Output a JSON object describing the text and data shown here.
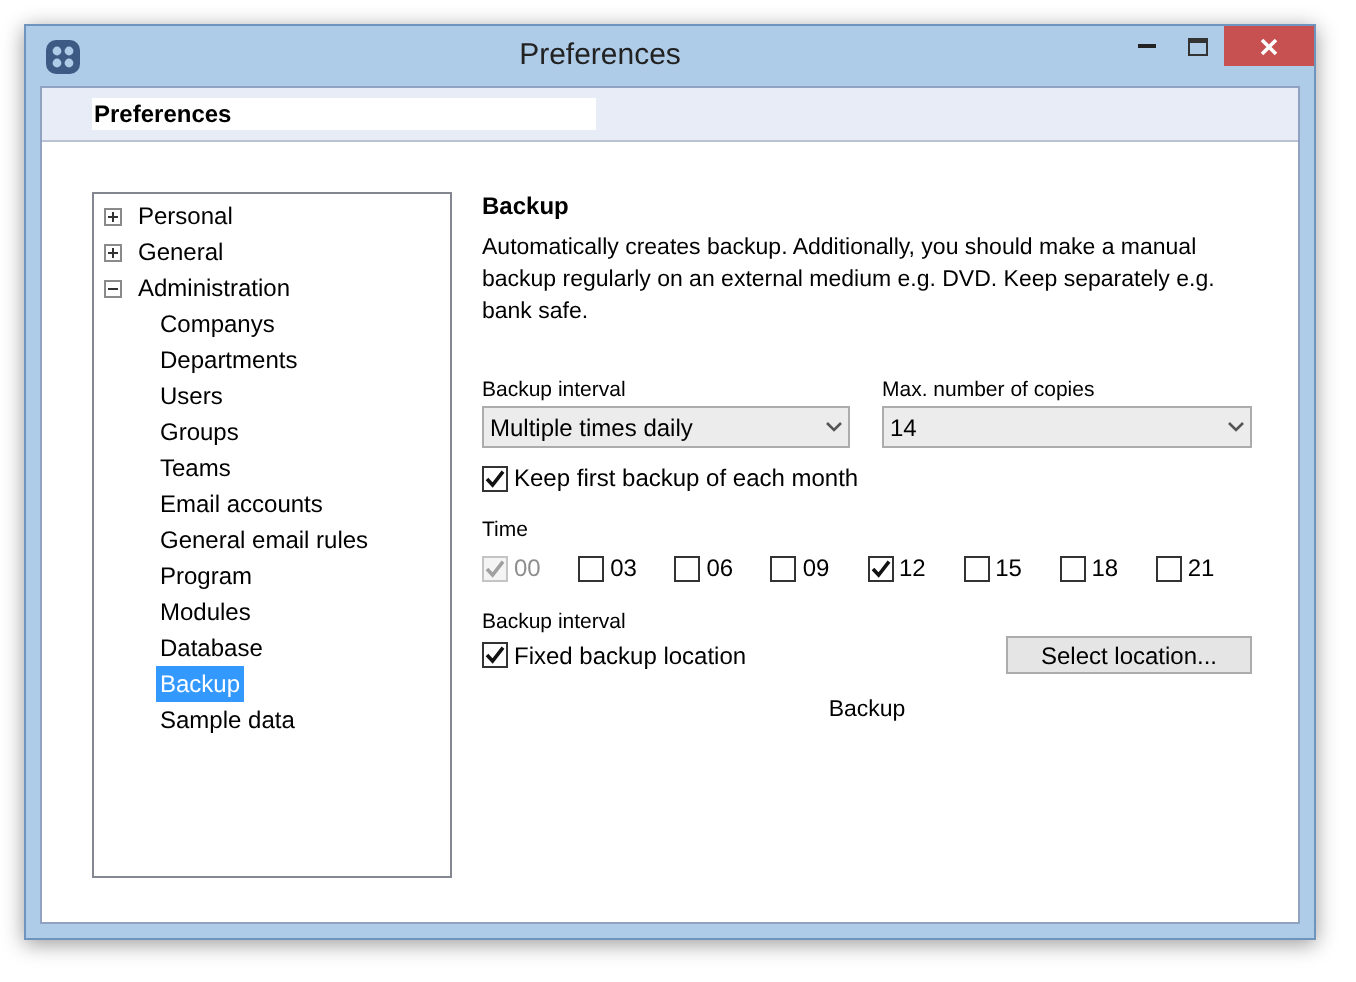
{
  "window": {
    "title": "Preferences"
  },
  "header": {
    "title": "Preferences"
  },
  "tree": [
    {
      "label": "Personal",
      "expanded": false,
      "selected": false
    },
    {
      "label": "General",
      "expanded": false,
      "selected": false
    },
    {
      "label": "Administration",
      "expanded": true,
      "selected": false,
      "children": [
        {
          "label": "Companys",
          "selected": false
        },
        {
          "label": "Departments",
          "selected": false
        },
        {
          "label": "Users",
          "selected": false
        },
        {
          "label": "Groups",
          "selected": false
        },
        {
          "label": "Teams",
          "selected": false
        },
        {
          "label": "Email accounts",
          "selected": false
        },
        {
          "label": "General email rules",
          "selected": false
        },
        {
          "label": "Program",
          "selected": false
        },
        {
          "label": "Modules",
          "selected": false
        },
        {
          "label": "Database",
          "selected": false
        },
        {
          "label": "Backup",
          "selected": true
        },
        {
          "label": "Sample data",
          "selected": false
        }
      ]
    }
  ],
  "section": {
    "title": "Backup",
    "description": "Automatically creates backup. Additionally, you should make a manual backup regularly on an external medium e.g. DVD. Keep separately e.g. bank safe."
  },
  "interval": {
    "label": "Backup interval",
    "value": "Multiple times daily"
  },
  "copies": {
    "label": "Max. number of copies",
    "value": "14"
  },
  "keep_first": {
    "label": "Keep first backup of each month",
    "checked": true
  },
  "time": {
    "label": "Time",
    "hours": [
      {
        "label": "00",
        "checked": true,
        "disabled": true
      },
      {
        "label": "03",
        "checked": false,
        "disabled": false
      },
      {
        "label": "06",
        "checked": false,
        "disabled": false
      },
      {
        "label": "09",
        "checked": false,
        "disabled": false
      },
      {
        "label": "12",
        "checked": true,
        "disabled": false
      },
      {
        "label": "15",
        "checked": false,
        "disabled": false
      },
      {
        "label": "18",
        "checked": false,
        "disabled": false
      },
      {
        "label": "21",
        "checked": false,
        "disabled": false
      }
    ]
  },
  "location": {
    "label": "Backup interval",
    "checkbox": "Fixed backup location",
    "checked": true,
    "button": "Select location..."
  },
  "footer": {
    "text": "Backup"
  }
}
